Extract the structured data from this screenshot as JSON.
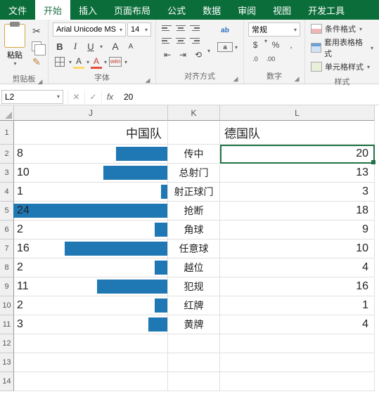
{
  "tabs": {
    "file": "文件",
    "home": "开始",
    "insert": "插入",
    "layout": "页面布局",
    "formulas": "公式",
    "data": "数据",
    "review": "审阅",
    "view": "视图",
    "dev": "开发工具"
  },
  "ribbon": {
    "clipboard": {
      "label": "剪贴板",
      "paste": "粘贴"
    },
    "font": {
      "label": "字体",
      "name": "Arial Unicode MS",
      "size": "14",
      "fill_char": "A",
      "color_char": "A",
      "wen": "wén"
    },
    "alignment": {
      "label": "对齐方式",
      "wrap": "ab",
      "merge": "a"
    },
    "number": {
      "label": "数字",
      "format": "常规",
      "currency": "$",
      "percent": "%",
      "comma": ",",
      "inc": ".0",
      "dec": ".00"
    },
    "styles": {
      "label": "样式",
      "cond": "条件格式",
      "table": "套用表格格式",
      "cell": "单元格样式"
    }
  },
  "formula_bar": {
    "name_box": "L2",
    "fx": "fx",
    "value": "20"
  },
  "columns": {
    "J": "J",
    "K": "K",
    "L": "L"
  },
  "headers": {
    "J": "中国队",
    "L": "德国队"
  },
  "chart_data": {
    "type": "bar",
    "categories": [
      "传中",
      "总射门",
      "射正球门",
      "抢断",
      "角球",
      "任意球",
      "越位",
      "犯规",
      "红牌",
      "黄牌"
    ],
    "series": [
      {
        "name": "中国队",
        "values": [
          8,
          10,
          1,
          24,
          2,
          16,
          2,
          11,
          2,
          3
        ]
      },
      {
        "name": "德国队",
        "values": [
          20,
          13,
          3,
          18,
          9,
          10,
          4,
          16,
          1,
          4
        ]
      }
    ],
    "bar_axis_max": 24
  },
  "selection": {
    "cell": "L2",
    "value": "20"
  }
}
